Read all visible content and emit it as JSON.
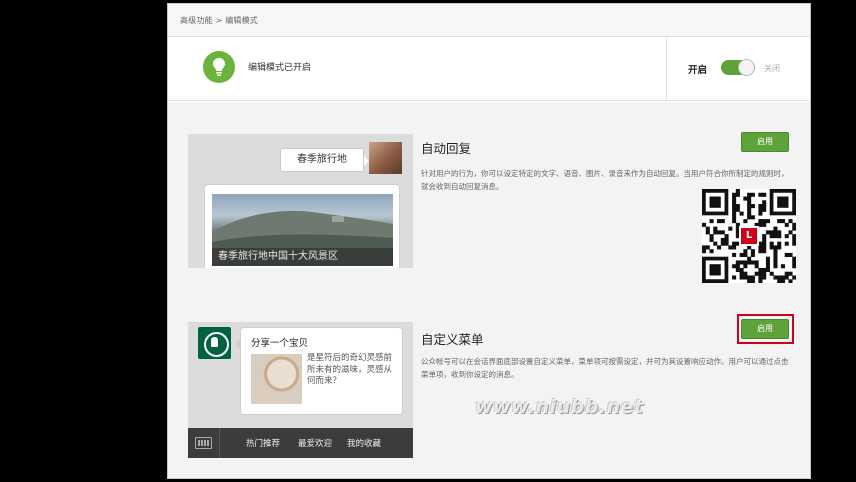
{
  "breadcrumb": "高级功能 > 编辑模式",
  "status": {
    "text": "编辑模式已开启",
    "switch_on_label": "开启",
    "switch_off_label": "关闭",
    "enabled": true
  },
  "auto_reply": {
    "title": "自动回复",
    "button_label": "启用",
    "description": "针对用户的行为，你可以设定特定的文字、语音、图片、录音来作为自动回复。当用户符合你所制定的规则时，就会收到自动回复消息。",
    "preview_message": "春季旅行地",
    "preview_caption": "春季旅行地中国十大风景区"
  },
  "custom_menu": {
    "title": "自定义菜单",
    "button_label": "启用",
    "description": "公众帐号可以在会话界面底部设置自定义菜单，菜单项可按需设定，并可为其设置响应动作。用户可以通过点击菜单项，收到你设定的消息。",
    "preview_title": "分享一个宝贝",
    "preview_text": "是星符后的奇幻灵感前所未有的滋味，灵感从何而来？",
    "menu_items": [
      "热门推荐",
      "最爱欢迎",
      "我的收藏"
    ]
  },
  "watermark": "www.niubb.net",
  "colors": {
    "accent_green": "#5ea23a",
    "highlight_red": "#d0021b"
  },
  "icons": {
    "status": "lightbulb-icon",
    "keyboard": "keyboard-icon"
  }
}
